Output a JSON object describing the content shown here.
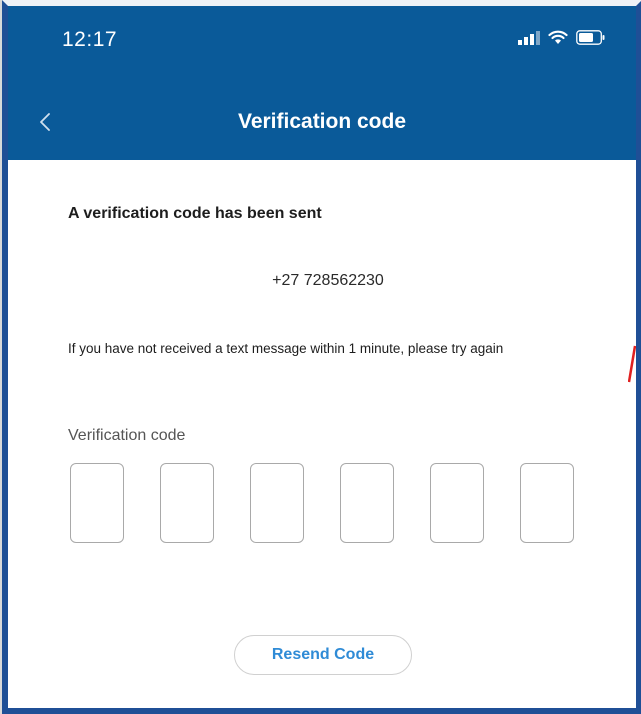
{
  "status_bar": {
    "time": "12:17"
  },
  "nav": {
    "title": "Verification code"
  },
  "main": {
    "sent_heading": "A verification code has been sent",
    "phone_number": "+27 728562230",
    "retry_text": "If you have not received a text message within 1 minute, please try again",
    "code_label": "Verification code",
    "code_digits": [
      "",
      "",
      "",
      "",
      "",
      ""
    ],
    "resend_label": "Resend Code"
  },
  "colors": {
    "header_bg": "#0a5a99",
    "frame_border": "#1f4f96",
    "resend_text": "#2f8bd6"
  },
  "icons": {
    "back": "chevron-left-icon",
    "signal": "cellular-signal-icon",
    "wifi": "wifi-icon",
    "battery": "battery-icon"
  }
}
